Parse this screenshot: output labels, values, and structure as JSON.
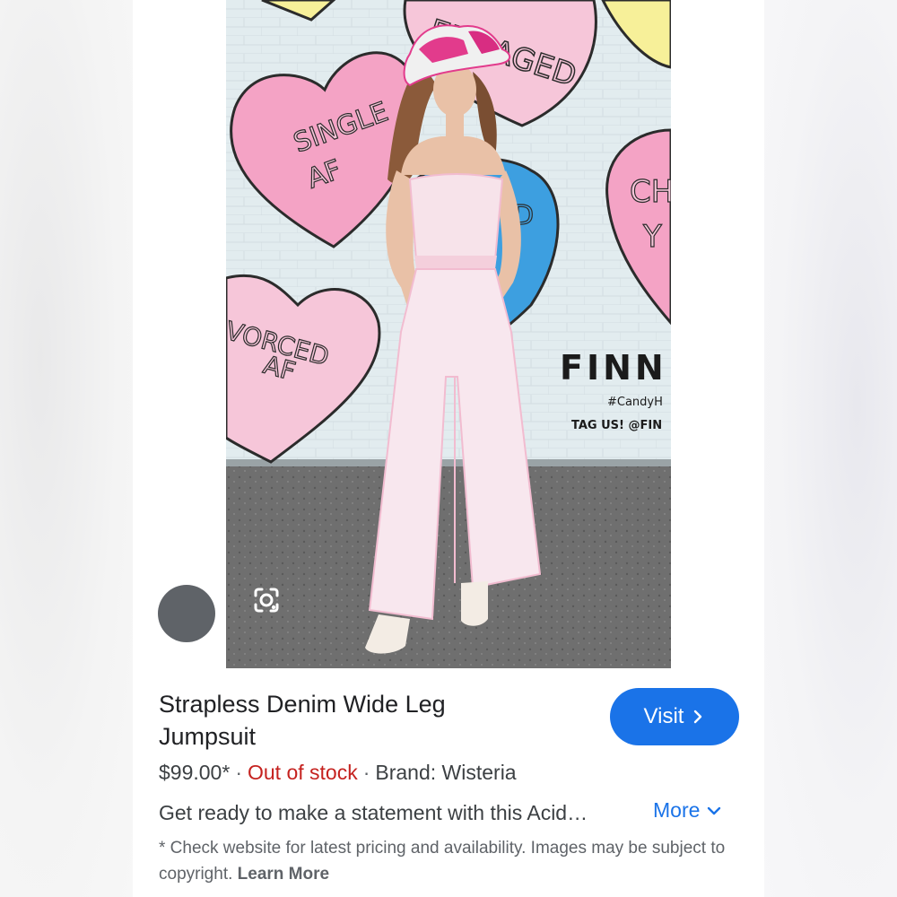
{
  "product": {
    "title": "Strapless Denim Wide Leg Jumpsuit",
    "price": "$99.00*",
    "separator": "·",
    "stock_status": "Out of stock",
    "brand": "Brand: Wisteria",
    "description": "Get ready to make a statement with this Acid…",
    "more_label": "More",
    "disclaimer_text": "* Check website for latest pricing and availability. Images may be subject to copyright.",
    "learn_more_label": "Learn More"
  },
  "actions": {
    "visit_label": "Visit",
    "lens_icon": "google-lens-icon",
    "chevron_right_icon": "chevron-right-icon",
    "chevron_down_icon": "chevron-down-icon"
  },
  "photo": {
    "mural_hearts": [
      "ENGAGED",
      "SINGLE AF",
      "DIVORCED AF",
      "CH Y",
      "D"
    ],
    "mural_sign": "FINN",
    "mural_hashtag": "#CandyH",
    "mural_tag": "TAG US! @FIN"
  },
  "colors": {
    "accent": "#1a73e8",
    "out_of_stock": "#c5221f",
    "text_primary": "#202124",
    "text_secondary": "#5f6368"
  }
}
